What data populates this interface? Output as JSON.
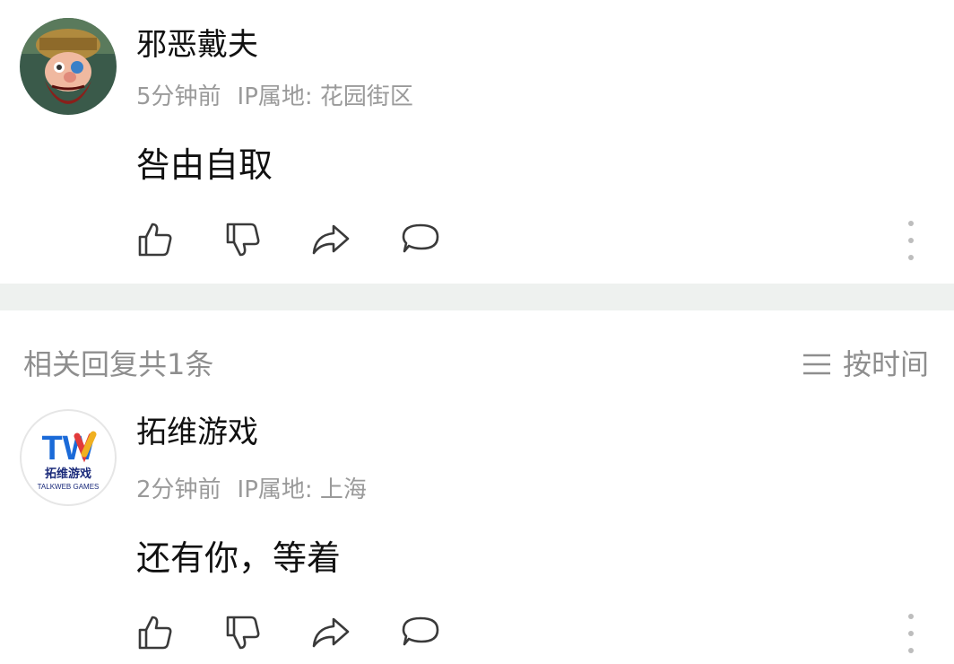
{
  "comment": {
    "username": "邪恶戴夫",
    "time": "5分钟前",
    "ip_location": "IP属地: 花园街区",
    "content": "咎由自取"
  },
  "replies_header": {
    "title": "相关回复共1条",
    "sort_label": "按时间",
    "sort_icon": "list-icon"
  },
  "reply": {
    "username": "拓维游戏",
    "avatar_logo_text": "TW",
    "avatar_brand_cn": "拓维游戏",
    "avatar_brand_en": "TALKWEB GAMES",
    "time": "2分钟前",
    "ip_location": "IP属地: 上海",
    "content": "还有你，等着"
  },
  "actions": [
    "thumbs-up-icon",
    "thumbs-down-icon",
    "share-icon",
    "comment-icon",
    "more-icon"
  ]
}
